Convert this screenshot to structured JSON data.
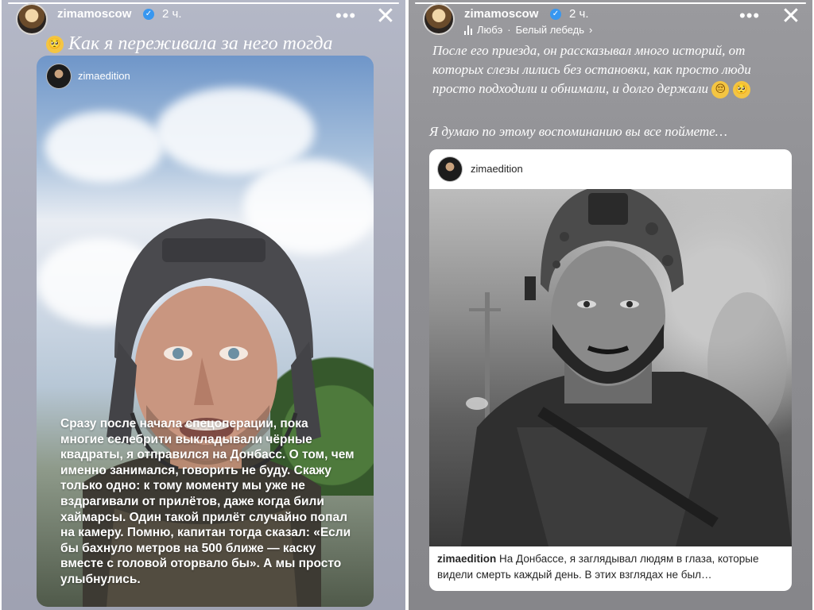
{
  "left_story": {
    "username": "zimamoscow",
    "time": "2 ч.",
    "more_label": "•••",
    "close_label": "✕",
    "caption": "Как я переживала за него тогда",
    "emoji": "🥺",
    "embedded_card": {
      "username": "zimaedition",
      "text": "Сразу после начала спецоперации, пока многие селебрити выкладывали чёрные квадраты, я отправился на Донбасс. О том, чем именно занимался, говорить не буду. Скажу только одно: к тому моменту мы уже не вздрагивали от прилётов, даже когда били хаймарсы. Один такой прилёт случайно попал на камеру. Помню, капитан тогда сказал: «Если бы бахнуло метров на 500 ближе — каску вместе с головой оторвало бы». А мы просто улыбнулись."
    }
  },
  "right_story": {
    "username": "zimamoscow",
    "time": "2 ч.",
    "more_label": "•••",
    "close_label": "✕",
    "music": {
      "artist": "Любэ",
      "separator": "·",
      "track": "Белый лебедь",
      "chevron": "›"
    },
    "caption_1": "После его приезда, он рассказывал много историй, от которых слезы лились без остановки, как просто люди просто подходили и обнимали, и долго держали",
    "emoji_1": "😔",
    "emoji_2": "🥺",
    "caption_2": "Я думаю по этому воспоминанию вы все поймете…",
    "post": {
      "username": "zimaedition",
      "caption_user": "zimaedition",
      "caption_text": "На Донбассе, я заглядывал людям в глаза, которые видели смерть каждый день. В этих взглядах не был…"
    }
  },
  "colors": {
    "verified": "#3897f0",
    "left_bg": "#a9acbb",
    "right_bg": "#8f8f93"
  }
}
